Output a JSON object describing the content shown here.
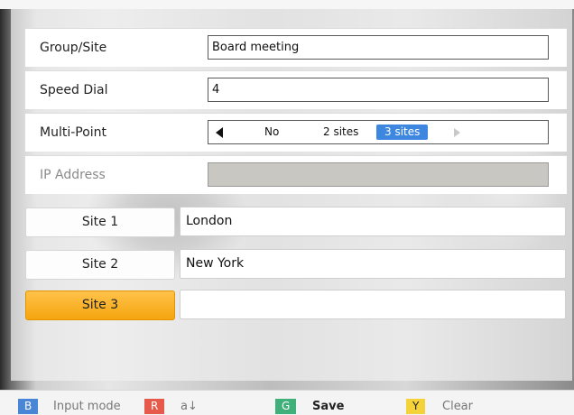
{
  "form": {
    "group_site": {
      "label": "Group∕Site",
      "value": "Board meeting"
    },
    "speed_dial": {
      "label": "Speed Dial",
      "value": "4"
    },
    "multi_point": {
      "label": "Multi-Point",
      "options": [
        "No",
        "2 sites",
        "3 sites"
      ],
      "selected": "3 sites"
    },
    "ip_address": {
      "label": "IP Address",
      "value": ""
    }
  },
  "sites": [
    {
      "label": "Site 1",
      "value": "London",
      "active": false
    },
    {
      "label": "Site 2",
      "value": "New York",
      "active": false
    },
    {
      "label": "Site 3",
      "value": "",
      "active": true
    }
  ],
  "footer": {
    "blue_key": "B",
    "blue_label": "Input mode",
    "red_key": "R",
    "red_label": "a↓",
    "green_key": "G",
    "green_label": "Save",
    "yellow_key": "Y",
    "yellow_label": "Clear"
  },
  "colors": {
    "accent_selected": "#3d87e0",
    "site_active": "#f5a50e",
    "key_blue": "#4a86d6",
    "key_red": "#e55a4a",
    "key_green": "#3fb07a",
    "key_yellow": "#f4d23a"
  }
}
